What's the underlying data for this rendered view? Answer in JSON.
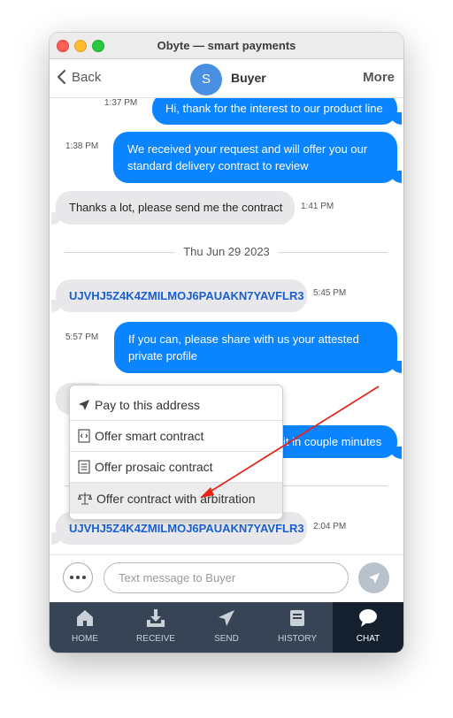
{
  "window": {
    "title": "Obyte — smart payments"
  },
  "nav": {
    "back_label": "Back",
    "avatar_letter": "S",
    "title": "Buyer",
    "more_label": "More"
  },
  "messages": [
    {
      "dir": "out",
      "text": "Hi, thank for the interest to our product line",
      "time": "1:37 PM"
    },
    {
      "dir": "out",
      "text": "We received your request and will offer you our standard delivery contract to review",
      "time": "1:38 PM"
    },
    {
      "dir": "in",
      "text": "Thanks a lot, please send me the contract",
      "time": "1:41 PM"
    },
    {
      "dir": "date",
      "text": "Thu Jun 29 2023"
    },
    {
      "dir": "in",
      "text": "UJVHJ5Z4K4ZMILMOJ6PAUAKN7YAVFLR3",
      "time": "5:45 PM",
      "is_link": true
    },
    {
      "dir": "out",
      "text": "If you can, please share with us your attested private profile",
      "time": "5:57 PM"
    },
    {
      "dir": "out",
      "text": "it in couple minutes",
      "partial": true
    },
    {
      "dir": "in",
      "text": "UJVHJ5Z4K4ZMILMOJ6PAUAKN7YAVFLR3",
      "time": "2:04 PM",
      "is_link": true
    }
  ],
  "context_menu": {
    "items": [
      {
        "label": "Pay to this address",
        "icon": "send-arrow-icon"
      },
      {
        "label": "Offer smart contract",
        "icon": "code-document-icon"
      },
      {
        "label": "Offer prosaic contract",
        "icon": "text-document-icon"
      },
      {
        "label": "Offer contract with arbitration",
        "icon": "scales-icon",
        "highlighted": true
      }
    ]
  },
  "composer": {
    "placeholder": "Text message to Buyer"
  },
  "tabs": [
    {
      "label": "HOME",
      "icon": "home-icon"
    },
    {
      "label": "RECEIVE",
      "icon": "receive-icon"
    },
    {
      "label": "SEND",
      "icon": "send-icon"
    },
    {
      "label": "HISTORY",
      "icon": "history-icon"
    },
    {
      "label": "CHAT",
      "icon": "chat-icon",
      "active": true
    }
  ],
  "colors": {
    "outgoing_bubble": "#0b84ff",
    "incoming_bubble": "#e8e8ea",
    "tabbar": "#374455",
    "tab_active": "#14202e",
    "annotation_arrow": "#e8231a"
  }
}
